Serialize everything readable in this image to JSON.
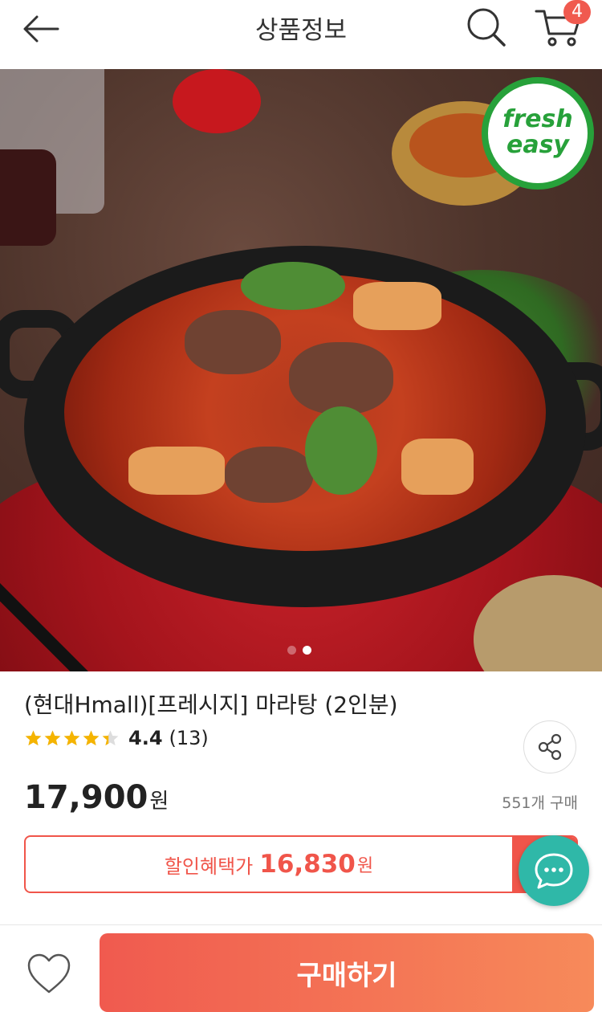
{
  "header": {
    "title": "상품정보",
    "cart_count": "4",
    "icons": [
      "back-arrow-icon",
      "search-icon",
      "cart-icon"
    ]
  },
  "hero": {
    "badge_line1": "fresh",
    "badge_line2": "easy",
    "page_indicator": {
      "total": 2,
      "active": 2
    }
  },
  "product": {
    "title": "(현대Hmall)[프레시지] 마라탕 (2인분)",
    "rating": "4.4",
    "review_count": "(13)",
    "rating_fraction": 0.88,
    "price": "17,900",
    "price_unit": "원",
    "sold": "551개 구매"
  },
  "discount": {
    "label": "할인혜택가",
    "price": "16,830",
    "unit": "원"
  },
  "bottom": {
    "buy_label": "구매하기"
  },
  "colors": {
    "accent": "#f05a4f",
    "star": "#f5b400",
    "chat": "#2fb8a8",
    "badge_green": "#27a13a"
  }
}
